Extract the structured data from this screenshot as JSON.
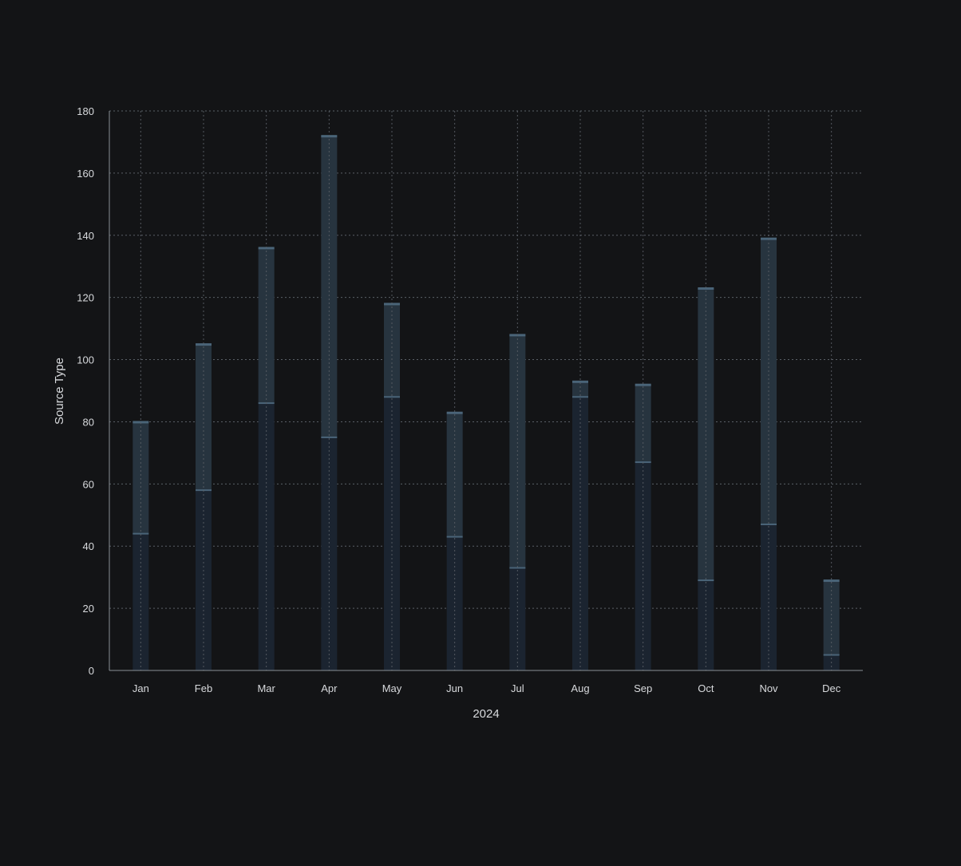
{
  "chart_data": {
    "type": "bar",
    "stacked": true,
    "categories": [
      "Jan",
      "Feb",
      "Mar",
      "Apr",
      "May",
      "Jun",
      "Jul",
      "Aug",
      "Sep",
      "Oct",
      "Nov",
      "Dec"
    ],
    "series": [
      {
        "values": [
          44,
          58,
          86,
          75,
          88,
          43,
          33,
          88,
          67,
          29,
          47,
          5
        ]
      },
      {
        "values": [
          36,
          47,
          50,
          97,
          30,
          40,
          75,
          5,
          25,
          94,
          92,
          24
        ]
      }
    ],
    "xlabel": "2024",
    "ylabel": "Source Type",
    "ylim": [
      0,
      180
    ],
    "yticks": [
      0,
      20,
      40,
      60,
      80,
      100,
      120,
      140,
      160,
      180
    ],
    "grid": true,
    "colors": {
      "background": "#131416",
      "lower_fill": "#1b2430",
      "upper_fill": "#27343f",
      "cap": "#4a6478",
      "grid": "#5a5f66",
      "axis": "#8a8f96",
      "text": "#d8dadd"
    }
  }
}
